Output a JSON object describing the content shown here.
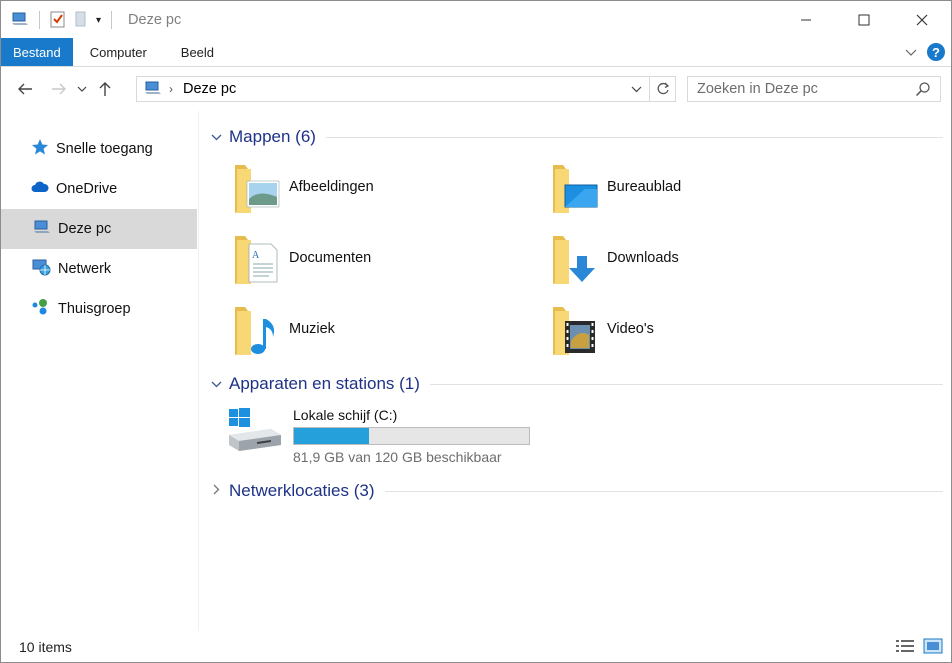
{
  "window": {
    "title": "Deze pc",
    "controls": {
      "minimize": "—",
      "maximize": "☐",
      "close": "✕"
    }
  },
  "ribbon": {
    "tabs": [
      "Bestand",
      "Computer",
      "Beeld"
    ],
    "help": "?"
  },
  "address": {
    "path": "Deze pc",
    "search_placeholder": "Zoeken in Deze pc"
  },
  "nav": {
    "items": [
      {
        "label": "Snelle toegang",
        "icon": "star-icon"
      },
      {
        "label": "OneDrive",
        "icon": "cloud-icon"
      },
      {
        "label": "Deze pc",
        "icon": "computer-icon",
        "selected": true
      },
      {
        "label": "Netwerk",
        "icon": "network-icon"
      },
      {
        "label": "Thuisgroep",
        "icon": "homegroup-icon"
      }
    ]
  },
  "groups": {
    "folders": {
      "title": "Mappen (6)",
      "items": [
        {
          "label": "Afbeeldingen",
          "icon": "pictures-folder-icon"
        },
        {
          "label": "Bureaublad",
          "icon": "desktop-folder-icon"
        },
        {
          "label": "Documenten",
          "icon": "documents-folder-icon"
        },
        {
          "label": "Downloads",
          "icon": "downloads-folder-icon"
        },
        {
          "label": "Muziek",
          "icon": "music-folder-icon"
        },
        {
          "label": "Video's",
          "icon": "videos-folder-icon"
        }
      ]
    },
    "devices": {
      "title": "Apparaten en stations (1)",
      "drive": {
        "name": "Lokale schijf (C:)",
        "free_text": "81,9 GB van 120 GB beschikbaar",
        "used_fraction": 0.318
      }
    },
    "network": {
      "title": "Netwerklocaties (3)"
    }
  },
  "status": {
    "count": "10 items"
  },
  "colors": {
    "accent": "#1979ca",
    "group_title": "#1e3287",
    "drive_fill": "#26a0da",
    "folder": "#f8d775"
  }
}
